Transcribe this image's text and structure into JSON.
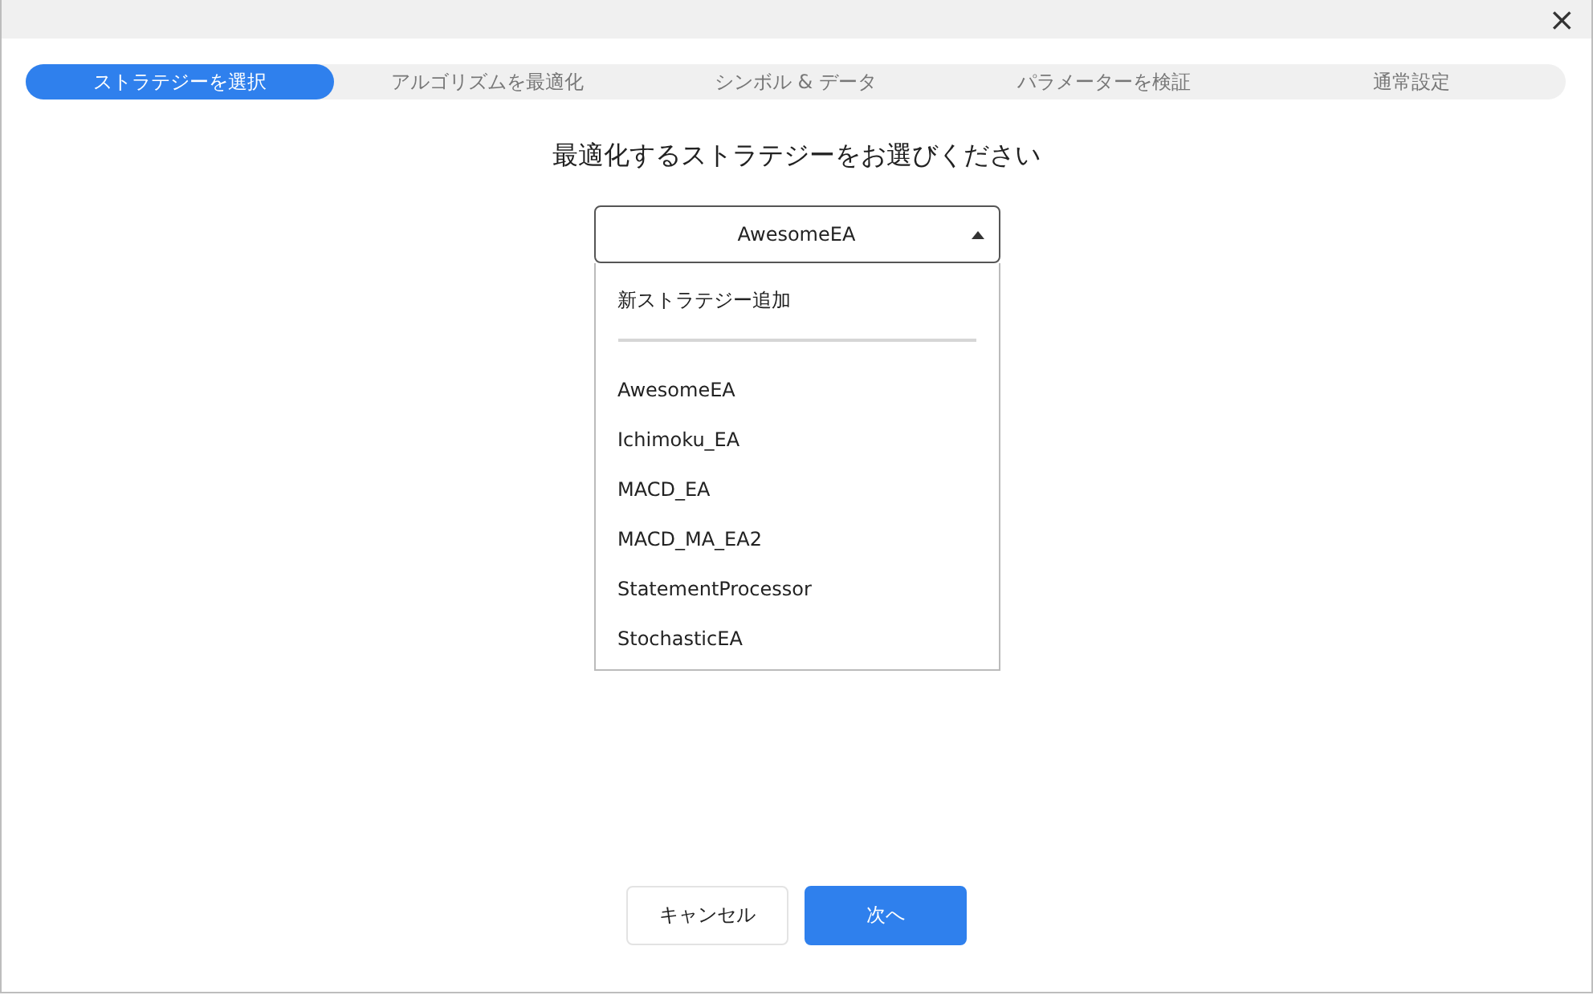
{
  "window": {
    "close_icon": "×"
  },
  "steps": [
    {
      "label": "ストラテジーを選択",
      "selected": true
    },
    {
      "label": "アルゴリズムを最適化",
      "selected": false
    },
    {
      "label": "シンボル & データ",
      "selected": false
    },
    {
      "label": "パラメーターを検証",
      "selected": false
    },
    {
      "label": "通常設定",
      "selected": false
    }
  ],
  "heading": "最適化するストラテジーをお選びください",
  "strategy_select": {
    "value": "AwesomeEA",
    "expanded": true,
    "add_item": "新ストラテジー追加",
    "options": [
      "AwesomeEA",
      "Ichimoku_EA",
      "MACD_EA",
      "MACD_MA_EA2",
      "StatementProcessor",
      "StochasticEA"
    ]
  },
  "buttons": {
    "cancel": "キャンセル",
    "next": "次へ"
  }
}
